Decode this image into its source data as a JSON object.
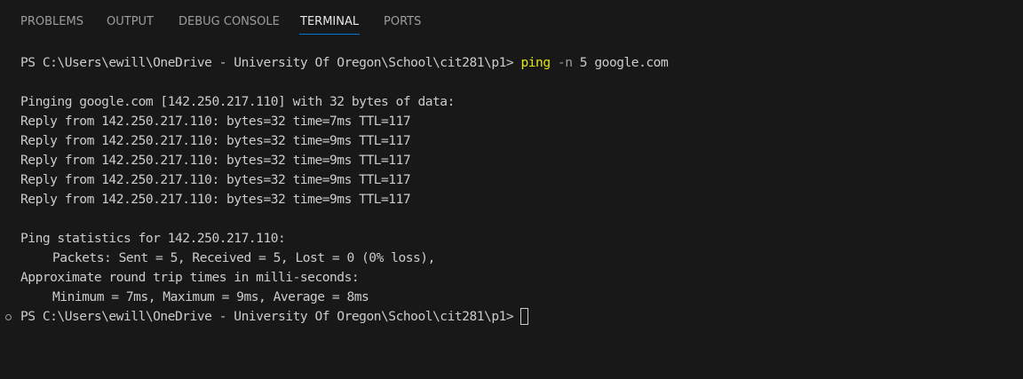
{
  "tabs": [
    "PROBLEMS",
    "OUTPUT",
    "DEBUG CONSOLE",
    "TERMINAL",
    "PORTS"
  ],
  "active_tab": "TERMINAL",
  "terminal": {
    "prompt": "PS C:\\Users\\ewill\\OneDrive - University Of Oregon\\School\\cit281\\p1> ",
    "command": {
      "name": "ping",
      "flag": "-n",
      "args": "5 google.com"
    },
    "output": {
      "pinging": "Pinging google.com [142.250.217.110] with 32 bytes of data:",
      "replies": [
        "Reply from 142.250.217.110: bytes=32 time=7ms TTL=117",
        "Reply from 142.250.217.110: bytes=32 time=9ms TTL=117",
        "Reply from 142.250.217.110: bytes=32 time=9ms TTL=117",
        "Reply from 142.250.217.110: bytes=32 time=9ms TTL=117",
        "Reply from 142.250.217.110: bytes=32 time=9ms TTL=117"
      ],
      "stats_header": "Ping statistics for 142.250.217.110:",
      "packets": "Packets: Sent = 5, Received = 5, Lost = 0 (0% loss),",
      "rtt_header": "Approximate round trip times in milli-seconds:",
      "rtt_values": "Minimum = 7ms, Maximum = 9ms, Average = 8ms"
    },
    "colors": {
      "background": "#181818",
      "text": "#cccccc",
      "command": "#e5e510",
      "flag": "#9d9d9d",
      "tab_inactive": "#9d9d9d",
      "tab_active": "#e7e7e7",
      "tab_underline": "#0078d4"
    }
  }
}
